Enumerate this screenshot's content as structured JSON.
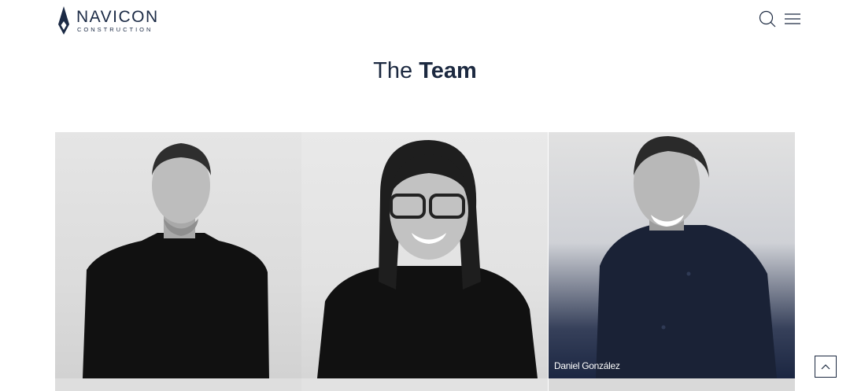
{
  "brand": {
    "name": "NAVICON",
    "tagline": "CONSTRUCTION"
  },
  "header": {
    "icons": [
      "search-icon",
      "menu-icon"
    ]
  },
  "section": {
    "title_light": "The",
    "title_bold": "Team"
  },
  "team": [
    {
      "name": "",
      "highlight": false
    },
    {
      "name": "",
      "highlight": false
    },
    {
      "name": "Daniel González",
      "highlight": true
    }
  ],
  "colors": {
    "navy": "#1c2940",
    "overlay": "#1b2641"
  },
  "scroll_top": {
    "icon": "chevron-up-icon"
  }
}
